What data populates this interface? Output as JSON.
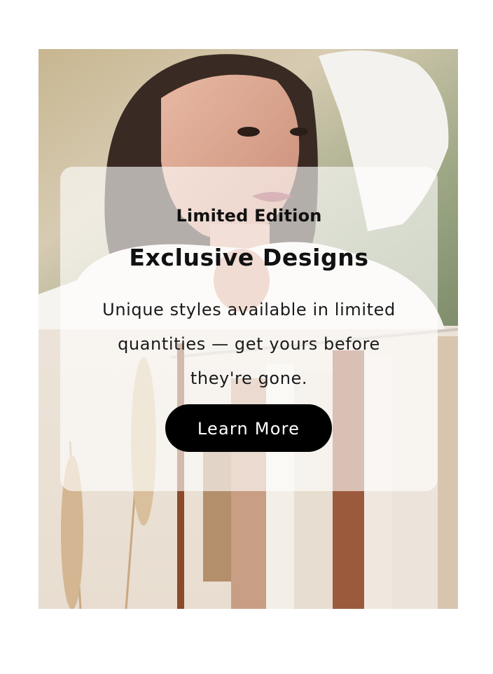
{
  "promo": {
    "eyebrow": "Limited Edition",
    "headline": "Exclusive Designs",
    "description": "Unique styles available in limited quantities — get yours before they're gone.",
    "cta_label": "Learn More"
  },
  "colors": {
    "cta_background": "#000000",
    "cta_text": "#ffffff",
    "card_overlay": "rgba(255,255,255,0.62)",
    "page_background": "#ffffff"
  }
}
